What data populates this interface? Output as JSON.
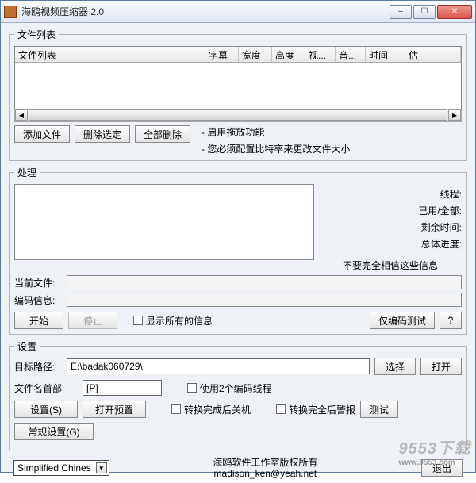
{
  "window": {
    "title": "海鸥视频压缩器 2.0"
  },
  "file_list": {
    "legend": "文件列表",
    "headers": [
      "文件列表",
      "字幕",
      "宽度",
      "高度",
      "视...",
      "音...",
      "时间",
      "估"
    ],
    "btn_add": "添加文件",
    "btn_remove_sel": "删除选定",
    "btn_remove_all": "全部删除",
    "note1": "- 启用拖放功能",
    "note2": "- 您必须配置比特率来更改文件大小"
  },
  "processing": {
    "legend": "处理",
    "threads_label": "线程:",
    "used_total_label": "已用/全部:",
    "remain_label": "剩余时间:",
    "overall_label": "总体进度:",
    "warn": "不要完全相信这些信息",
    "cur_file_label": "当前文件:",
    "enc_info_label": "编码信息:",
    "btn_start": "开始",
    "btn_stop": "停止",
    "chk_showall": "显示所有的信息",
    "btn_enc_test": "仅编码测试",
    "btn_help": "?"
  },
  "settings": {
    "legend": "设置",
    "target_label": "目标路径:",
    "target_value": "E:\\badak060729\\",
    "btn_select": "选择",
    "btn_open": "打开",
    "prefix_label": "文件名首部",
    "prefix_value": "[P]",
    "chk_two_threads": "使用2个编码线程",
    "btn_settings_s": "设置(S)",
    "btn_open_preset": "打开预置",
    "chk_shutdown": "转换完成后关机",
    "chk_alarm": "转换完全后警报",
    "btn_test": "测试",
    "btn_general_g": "常规设置(G)"
  },
  "footer": {
    "lang_label": "Simplified Chines",
    "credit_line1": "海鸥软件工作室版权所有",
    "credit_line2": "madison_ken@yeah.net",
    "btn_exit": "退出"
  },
  "watermark": {
    "text": "9553",
    "sub": "www.9553.com"
  }
}
